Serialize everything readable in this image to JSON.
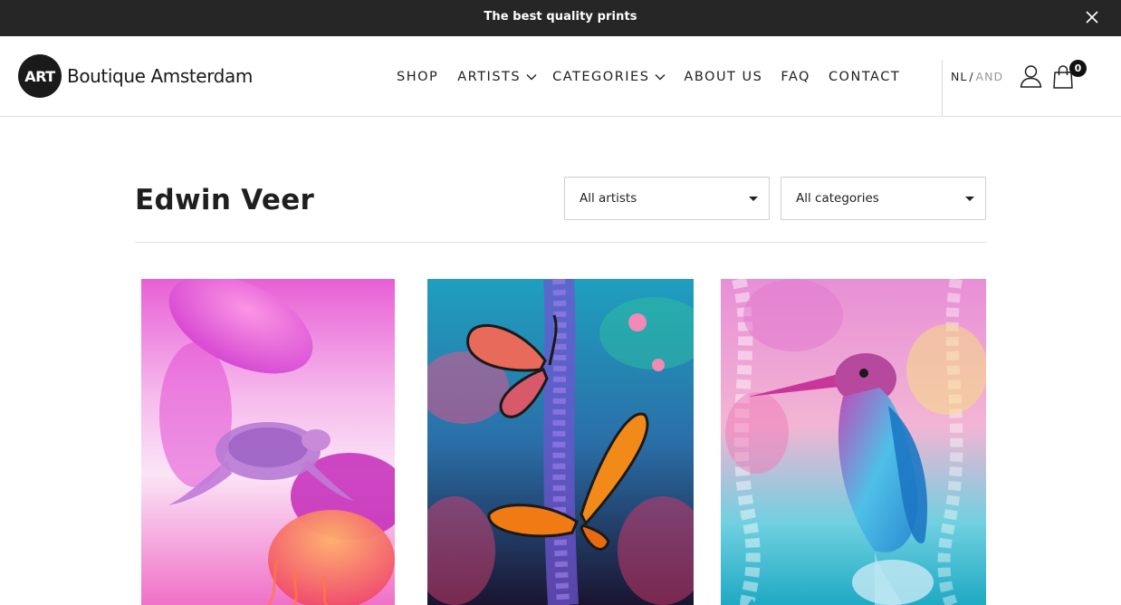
{
  "announcement": {
    "text": "The best quality prints"
  },
  "brand": {
    "badge": "ART",
    "name": "Boutique Amsterdam"
  },
  "nav": {
    "shop": "SHOP",
    "artists": "ARTISTS",
    "categories": "CATEGORIES",
    "about": "ABOUT US",
    "faq": "FAQ",
    "contact": "CONTACT"
  },
  "language": {
    "current": "NL",
    "separator": "/",
    "other": "AND"
  },
  "cart": {
    "count": "0"
  },
  "page": {
    "title": "Edwin Veer"
  },
  "filters": {
    "artists": {
      "selected": "All artists"
    },
    "categories": {
      "selected": "All categories"
    }
  },
  "products": [
    {
      "subject": "sea turtle with jellyfish",
      "palette": [
        "#f06ad8",
        "#fbd6f2",
        "#ff8a3c"
      ]
    },
    {
      "subject": "monarch butterflies with flowers",
      "palette": [
        "#1aa6c4",
        "#ff7a1a",
        "#7b5cd6"
      ]
    },
    {
      "subject": "kingfisher with jellyfish",
      "palette": [
        "#e98ad6",
        "#3ec9e0",
        "#f2a8c4"
      ]
    }
  ],
  "colors": {
    "topbar": "#262626",
    "text": "#1f1f1f",
    "muted": "#9a9a9a"
  }
}
